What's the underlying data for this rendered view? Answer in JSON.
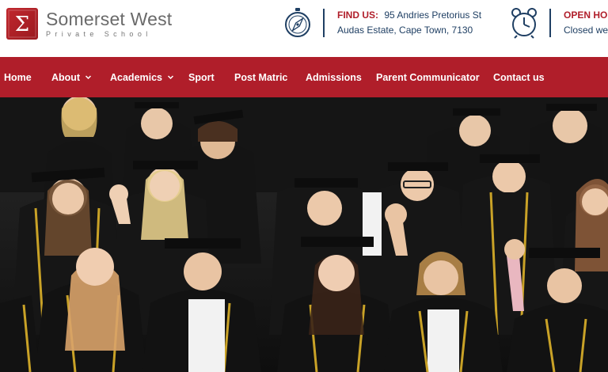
{
  "brand": {
    "name": "Somerset West",
    "subtitle": "Private School",
    "mark": "Σ"
  },
  "contact": {
    "find_label": "FIND US:",
    "address_line1": "95 Andries Pretorius St",
    "address_line2": "Audas Estate, Cape Town, 7130",
    "open_label": "OPEN HO",
    "open_line2": "Closed we",
    "find_icon": "compass-icon",
    "open_icon": "alarm-clock-icon"
  },
  "nav": {
    "items": [
      {
        "label": "Home"
      },
      {
        "label": "About"
      },
      {
        "label": "Academics"
      },
      {
        "label": "Sport"
      },
      {
        "label": "Post Matric"
      },
      {
        "label": "Admissions"
      },
      {
        "label": "Parent Communicator"
      },
      {
        "label": "Contact us"
      }
    ]
  },
  "colors": {
    "brand_red": "#b01e2a",
    "navy": "#1f3f63",
    "gown_black": "#151515",
    "gown_trim": "#c9a227"
  },
  "hero": {
    "alt_icon": "graduates-photo"
  }
}
